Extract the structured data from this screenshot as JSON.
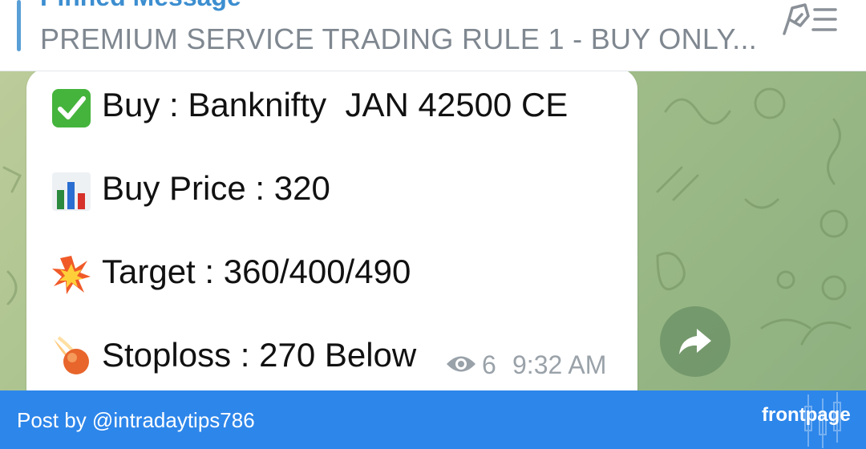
{
  "pinned": {
    "title": "Pinned Message",
    "text": "PREMIUM SERVICE  TRADING RULE  1 - BUY ONLY...",
    "icon": "pin-list-icon"
  },
  "message": {
    "lines": [
      {
        "icon": "check-mark-icon",
        "text": "Buy : Banknifty  JAN 42500 CE"
      },
      {
        "icon": "bar-chart-icon",
        "text": "Buy Price : 320"
      },
      {
        "icon": "collision-icon",
        "text": "Target : 360/400/490"
      },
      {
        "icon": "comet-icon",
        "text": "Stoploss : 270 Below"
      }
    ],
    "views": "6",
    "time": "9:32 AM"
  },
  "footer": {
    "post_by": "Post by @intradaytips786",
    "brand": "frontpage"
  },
  "colors": {
    "accent": "#3c8ed0",
    "footer_bg": "#2d86ea",
    "chat_bg": "#a9c28e",
    "bubble_bg": "#ffffff",
    "meta_text": "#9aa2a9"
  }
}
